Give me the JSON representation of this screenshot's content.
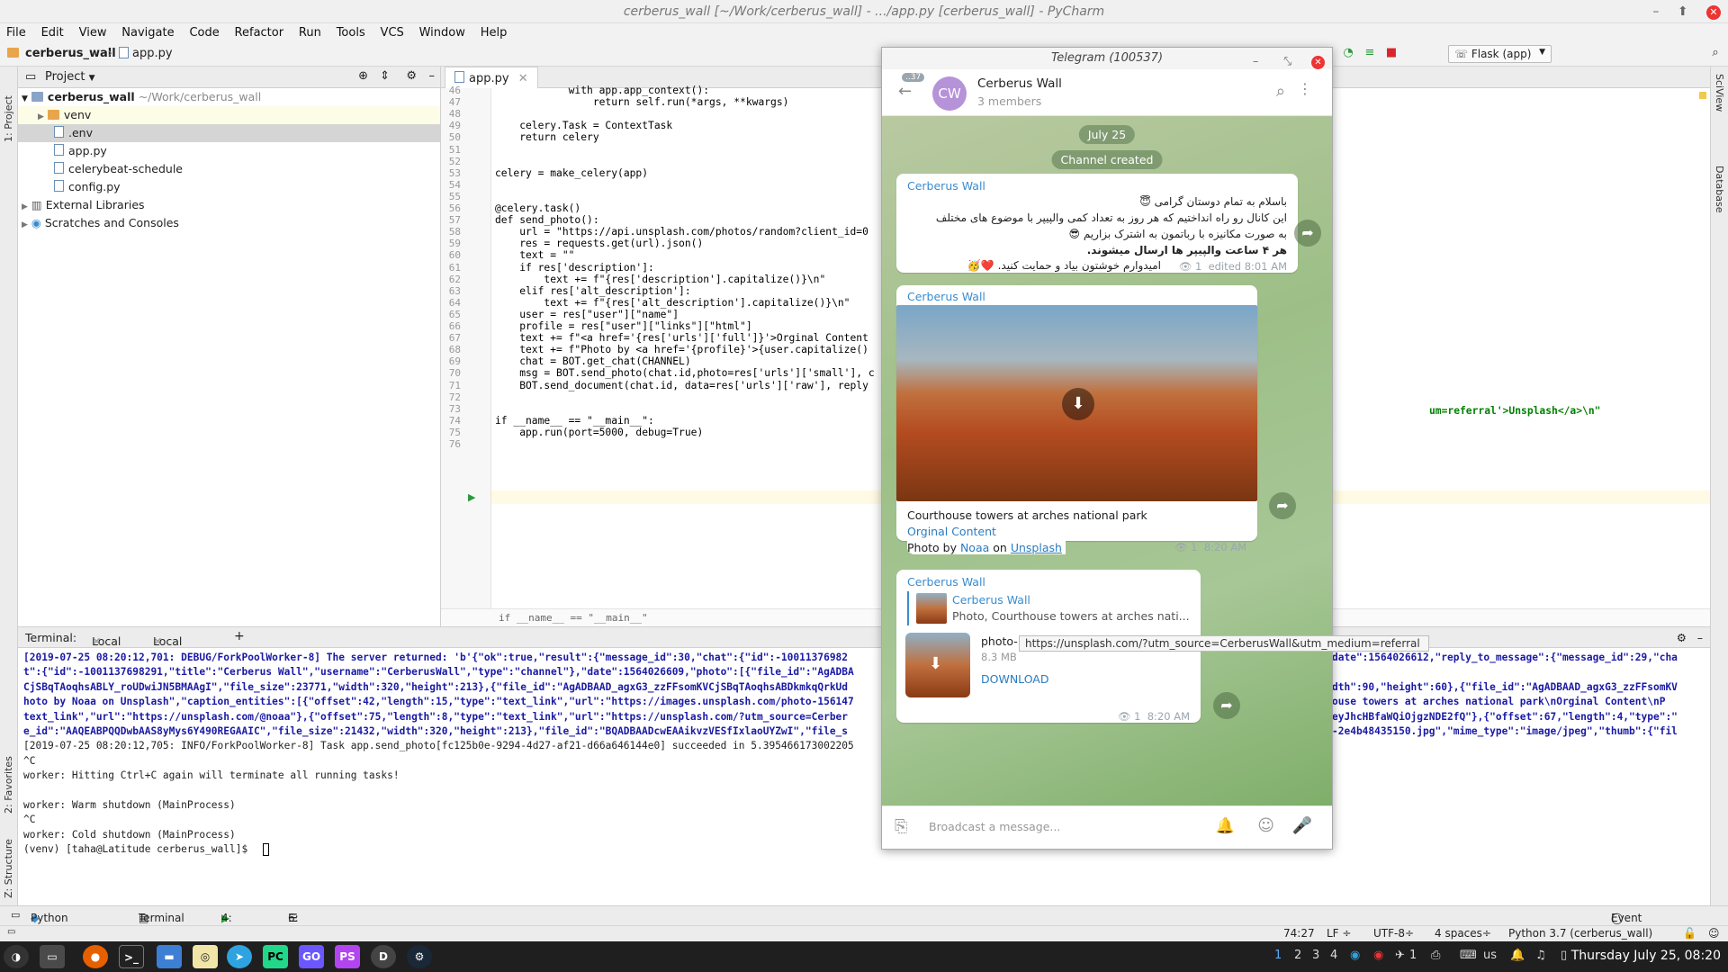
{
  "window": {
    "title": "cerberus_wall [~/Work/cerberus_wall] - .../app.py [cerberus_wall] - PyCharm",
    "close": "✕",
    "minimize": "–",
    "maximize": "⬆"
  },
  "menu": [
    "File",
    "Edit",
    "View",
    "Navigate",
    "Code",
    "Refactor",
    "Run",
    "Tools",
    "VCS",
    "Window",
    "Help"
  ],
  "nav": {
    "project": "cerberus_wall",
    "file": "app.py",
    "run_config": "Flask (app)"
  },
  "left_strip": {
    "project": "1: Project",
    "favorites": "2: Favorites",
    "structure": "Z: Structure"
  },
  "right_strip": {
    "sciview": "SciView",
    "database": "Database"
  },
  "project_panel": {
    "header": "Project",
    "tree": [
      {
        "label": "cerberus_wall",
        "extra": "~/Work/cerberus_wall"
      },
      {
        "label": "venv",
        "extra": ""
      },
      {
        "label": ".env",
        "extra": ""
      },
      {
        "label": "app.py",
        "extra": ""
      },
      {
        "label": "celerybeat-schedule",
        "extra": ""
      },
      {
        "label": "config.py",
        "extra": ""
      },
      {
        "label": "External Libraries",
        "extra": ""
      },
      {
        "label": "Scratches and Consoles",
        "extra": ""
      }
    ]
  },
  "editor": {
    "tab": "app.py",
    "breadcrumb": "if __name__ == \"__main__\"",
    "line_numbers": [
      "46",
      "47",
      "48",
      "49",
      "50",
      "51",
      "52",
      "53",
      "54",
      "55",
      "56",
      "57",
      "58",
      "59",
      "60",
      "61",
      "62",
      "63",
      "64",
      "65",
      "66",
      "67",
      "68",
      "69",
      "70",
      "71",
      "72",
      "73",
      "74",
      "75",
      "76"
    ],
    "lines": [
      "            with app.app_context():",
      "                return self.run(*args, **kwargs)",
      "",
      "    celery.Task = ContextTask",
      "    return celery",
      "",
      "",
      "celery = make_celery(app)",
      "",
      "",
      "@celery.task()",
      "def send_photo():",
      "    url = \"https://api.unsplash.com/photos/random?client_id=0",
      "    res = requests.get(url).json()",
      "    text = \"\"",
      "    if res['description']:",
      "        text += f\"{res['description'].capitalize()}\\n\"",
      "    elif res['alt_description']:",
      "        text += f\"{res['alt_description'].capitalize()}\\n\"",
      "    user = res[\"user\"][\"name\"]",
      "    profile = res[\"user\"][\"links\"][\"html\"]",
      "    text += f\"<a href='{res['urls']['full']}'>Orginal Content",
      "    text += f\"Photo by <a href='{profile}'>{user.capitalize()",
      "    chat = BOT.get_chat(CHANNEL)",
      "    msg = BOT.send_photo(chat.id,photo=res['urls']['small'], c",
      "    BOT.send_document(chat.id, data=res['urls']['raw'], reply",
      "",
      "",
      "if __name__ == \"__main__\":",
      "    app.run(port=5000, debug=True)",
      ""
    ],
    "overflow_line": "um=referral'>Unsplash</a>\\n\""
  },
  "terminal": {
    "label": "Terminal:",
    "tabs": [
      "Local",
      "Local (2)"
    ],
    "add": "+",
    "lines": [
      "[2019-07-25 08:20:12,701: DEBUG/ForkPoolWorker-8] The server returned: 'b'{\"ok\":true,\"result\":{\"message_id\":30,\"chat\":{\"id\":-10011376982",
      "t\":{\"id\":-1001137698291,\"title\":\"Cerberus Wall\",\"username\":\"CerberusWall\",\"type\":\"channel\"},\"date\":1564026609,\"photo\":[{\"file_id\":\"AgADBA",
      "CjSBqTAoqhsABLY_roUDwiJN5BMAAgI\",\"file_size\":23771,\"width\":320,\"height\":213},{\"file_id\":\"AgADBAAD_agxG3_zzFFsomKVCjSBqTAoqhsABDkmkqQrkUd",
      "hoto by Noaa on Unsplash\",\"caption_entities\":[{\"offset\":42,\"length\":15,\"type\":\"text_link\",\"url\":\"https://images.unsplash.com/photo-156147",
      "text_link\",\"url\":\"https://unsplash.com/@noaa\"},{\"offset\":75,\"length\":8,\"type\":\"text_link\",\"url\":\"https://unsplash.com/?utm_source=Cerber",
      "e_id\":\"AAQEABPQQDwbAAS8yMys6Y490REGAAIC\",\"file_size\":21432,\"width\":320,\"height\":213},\"file_id\":\"BQADBAADcwEAAikvzVESfIxlaoUYZwI\",\"file_s",
      "[2019-07-25 08:20:12,705: INFO/ForkPoolWorker-8] Task app.send_photo[fc125b0e-9294-4d27-af21-d66a646144e0] succeeded in 5.395466173002205",
      "^C",
      "worker: Hitting Ctrl+C again will terminate all running tasks!",
      "",
      "worker: Warm shutdown (MainProcess)",
      "^C",
      "worker: Cold shutdown (MainProcess)",
      "(venv) [taha@Latitude cerberus_wall]$ "
    ],
    "right_parts": [
      "date\":1564026612,\"reply_to_message\":{\"message_id\":29,\"cha",
      "dth\":90,\"height\":60},{\"file_id\":\"AgADBAAD_agxG3_zzFFsomKV",
      "ouse towers at arches national park\\nOrginal Content\\nP",
      "eyJhcHBfaWQiOjgzNDE2fQ\"},{\"offset\":67,\"length\":4,\"type\":\"",
      "-2e4b48435150.jpg\",\"mime_type\":\"image/jpeg\",\"thumb\":{\"fil"
    ]
  },
  "bottom_tabs": [
    "Python Console",
    "Terminal",
    "4: Run",
    "6: TODO",
    "Event Log"
  ],
  "status": {
    "position": "74:27",
    "line_sep": "LF ÷",
    "encoding": "UTF-8÷",
    "indent": "4 spaces÷",
    "interpreter": "Python 3.7 (cerberus_wall)"
  },
  "telegram": {
    "title": "Telegram (100537)",
    "badge": "37",
    "avatar": "CW",
    "chat_name": "Cerberus Wall",
    "members": "3 members",
    "date_pill": "July 25",
    "created_pill": "Channel created",
    "msg1": {
      "sender": "Cerberus Wall",
      "line1": "باسلام به تمام دوستان گرامی 😇",
      "line2": "این کانال رو راه انداختیم که هر روز به تعداد کمی والپیپر با موضوع های مختلف",
      "line3": "به صورت مکانیزه با رباتمون به اشترک بزاریم 😎",
      "line4": "هر ۴ ساعت والپیپر ها ارسال میشوند.",
      "line5": "امیدوارم خوشتون بیاد و حمایت کنید. ❤️🥳",
      "views": "1",
      "time": "edited 8:01 AM"
    },
    "msg2": {
      "sender": "Cerberus Wall",
      "caption": "Courthouse towers at arches national park",
      "link": "Orginal Content",
      "photo_by": "Photo by",
      "author": "Noaa",
      "on": "on",
      "site": "Unsplash",
      "views": "1",
      "time": "8:20 AM"
    },
    "tooltip": "https://unsplash.com/?utm_source=CerberusWall&utm_medium=referral",
    "msg3": {
      "sender": "Cerberus Wall",
      "reply_name": "Cerberus Wall",
      "reply_text": "Photo, Courthouse towers at arches nati...",
      "file_name": "photo-1561470872-2e4b48435150.jpg",
      "file_size": "8.3 MB",
      "download": "DOWNLOAD",
      "views": "1",
      "time": "8:20 AM"
    },
    "input_placeholder": "Broadcast a message..."
  },
  "taskbar": {
    "workspaces": [
      "1",
      "2",
      "3",
      "4"
    ],
    "lang": "us",
    "clock": "Thursday July 25, 08:20",
    "badge": "1",
    "apps": [
      "PC",
      "GO",
      "PS",
      "D"
    ]
  }
}
